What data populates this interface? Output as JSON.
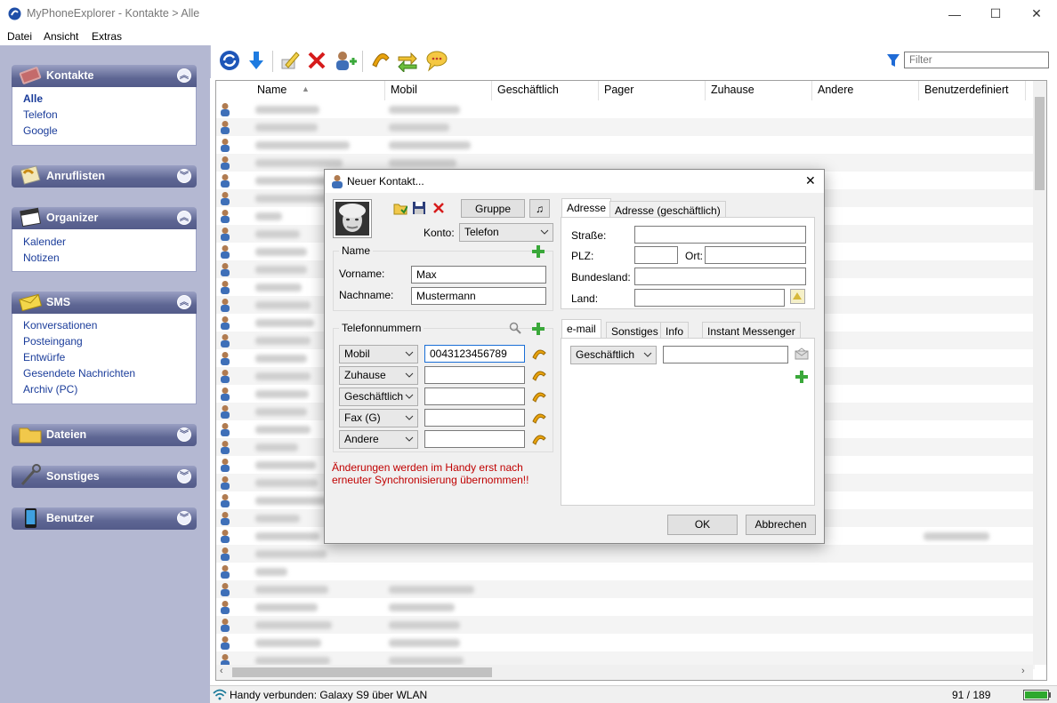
{
  "app": {
    "title": "MyPhoneExplorer -  Kontakte > Alle",
    "window_controls": {
      "minimize": "—",
      "maximize": "☐",
      "close": "✕"
    }
  },
  "menu": [
    "Datei",
    "Ansicht",
    "Extras"
  ],
  "sidebar": {
    "groups": [
      {
        "label": "Kontakte",
        "icon": "contacts-book-icon",
        "items": [
          "Alle",
          "Telefon",
          "Google"
        ],
        "expanded": true
      },
      {
        "label": "Anruflisten",
        "icon": "call-list-icon",
        "items": [],
        "expanded": false
      },
      {
        "label": "Organizer",
        "icon": "organizer-calendar-icon",
        "items": [
          "Kalender",
          "Notizen"
        ],
        "expanded": true
      },
      {
        "label": "SMS",
        "icon": "sms-envelope-icon",
        "items": [
          "Konversationen",
          "Posteingang",
          "Entwürfe",
          "Gesendete Nachrichten",
          "Archiv (PC)"
        ],
        "expanded": true
      },
      {
        "label": "Dateien",
        "icon": "folder-icon",
        "items": [],
        "expanded": false
      },
      {
        "label": "Sonstiges",
        "icon": "tools-icon",
        "items": [],
        "expanded": false
      },
      {
        "label": "Benutzer",
        "icon": "phone-device-icon",
        "items": [],
        "expanded": false
      }
    ],
    "chevron_up": "︽",
    "chevron_down": "︾"
  },
  "toolbar": {
    "filter_placeholder": "Filter"
  },
  "grid": {
    "columns": [
      "Name",
      "Mobil",
      "Geschäftlich",
      "Pager",
      "Zuhause",
      "Andere",
      "Benutzerdefiniert"
    ],
    "sort_indicator": "▲"
  },
  "dialog": {
    "title": "Neuer Kontakt...",
    "close": "✕",
    "group_button": "Gruppe",
    "music_button": "♫",
    "account_label": "Konto:",
    "account_value": "Telefon",
    "name_section": "Name",
    "first_name_label": "Vorname:",
    "first_name_value": "Max",
    "last_name_label": "Nachname:",
    "last_name_value": "Mustermann",
    "phones_section": "Telefonnummern",
    "phones": [
      {
        "type": "Mobil",
        "value": "0043123456789"
      },
      {
        "type": "Zuhause",
        "value": ""
      },
      {
        "type": "Geschäftlich",
        "value": ""
      },
      {
        "type": "Fax (G)",
        "value": ""
      },
      {
        "type": "Andere",
        "value": ""
      }
    ],
    "warning": "Änderungen werden im Handy erst nach erneuter Synchronisierung übernommen!!",
    "address_tabs": [
      "Adresse",
      "Adresse (geschäftlich)"
    ],
    "street_label": "Straße:",
    "zip_label": "PLZ:",
    "city_label": "Ort:",
    "state_label": "Bundesland:",
    "country_label": "Land:",
    "info_tabs": [
      "e-mail",
      "Sonstiges",
      "Info",
      "Instant Messenger"
    ],
    "email_type": "Geschäftlich",
    "email_value": "",
    "ok": "OK",
    "cancel": "Abbrechen"
  },
  "status": {
    "connection": "Handy verbunden: Galaxy S9 über WLAN",
    "count": "91 / 189"
  },
  "colors": {
    "accent": "#1a3c9a",
    "warning": "#c00000",
    "sidebar": "#b4b8d2"
  }
}
